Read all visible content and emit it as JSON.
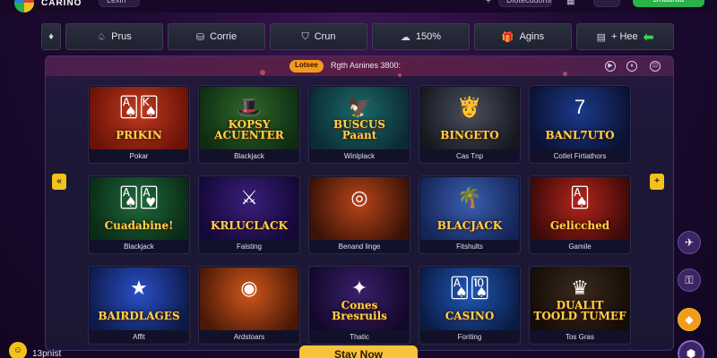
{
  "topbar": {
    "brand": "CARINO",
    "pill_left": "Lexin",
    "pill_right": "Dlotecudons",
    "right_button": "Drlaurau"
  },
  "nav": {
    "tabs": [
      {
        "icon": "diamond-icon",
        "label": "",
        "glyph": "♦"
      },
      {
        "icon": "cards-icon",
        "label": "Prus",
        "glyph": "♤"
      },
      {
        "icon": "chest-icon",
        "label": "Corrie",
        "glyph": "⛁"
      },
      {
        "icon": "shield-icon",
        "label": "Crun",
        "glyph": "⛉"
      },
      {
        "icon": "cloud-icon",
        "label": "150%",
        "glyph": "☁"
      },
      {
        "icon": "gift-icon",
        "label": "Agins",
        "glyph": "🎁"
      },
      {
        "icon": "wallet-icon",
        "label": "+ Hee",
        "glyph": "▤"
      }
    ]
  },
  "panel": {
    "badge": "Lotsee",
    "heading": "Rgth  Asnines  3800:",
    "controls": [
      "▶",
      "⏸",
      "⊡"
    ]
  },
  "games": [
    {
      "label": "Pokar",
      "art": "PRIKIN",
      "deco": "🂡🂮",
      "bg": [
        "#c0391e",
        "#6a1208"
      ]
    },
    {
      "label": "Blackjack",
      "art": "KOPSY\nACUENTER",
      "deco": "🎩",
      "bg": [
        "#2e6a2a",
        "#0f2c12"
      ]
    },
    {
      "label": "Winlplack",
      "art": "BUSCUS\nPaant",
      "deco": "🦅",
      "bg": [
        "#1c6a6a",
        "#0b2a33"
      ]
    },
    {
      "label": "Cas Tnp",
      "art": "BINGETO",
      "deco": "👸",
      "bg": [
        "#4a4f5e",
        "#16181f"
      ]
    },
    {
      "label": "Cotlet Firtiathors",
      "art": "BANL7UTO",
      "deco": "7",
      "bg": [
        "#1b3a8a",
        "#0a1233"
      ]
    },
    {
      "label": "Blackjack",
      "art": "Cuadabine!",
      "deco": "🂡🂱",
      "bg": [
        "#1f6a3a",
        "#0a2a16"
      ]
    },
    {
      "label": "Falsting",
      "art": "KRLUCLACK",
      "deco": "⚔",
      "bg": [
        "#3a1e7a",
        "#140838"
      ]
    },
    {
      "label": "Benand linge",
      "art": "",
      "deco": "◎",
      "bg": [
        "#b8441a",
        "#3a1206"
      ]
    },
    {
      "label": "Fitshults",
      "art": "BLACJACK",
      "deco": "🌴",
      "bg": [
        "#3a5fb0",
        "#142456"
      ]
    },
    {
      "label": "Gamile",
      "art": "Gelicched",
      "deco": "🂡",
      "bg": [
        "#b5241c",
        "#3a0a08"
      ]
    },
    {
      "label": "Afflt",
      "art": "BAIRDLAGES",
      "deco": "★",
      "bg": [
        "#2a50c8",
        "#0d1a4a"
      ]
    },
    {
      "label": "Ardstoars",
      "art": "",
      "deco": "◉",
      "bg": [
        "#d0561c",
        "#4a1806"
      ]
    },
    {
      "label": "Thatic",
      "art": "Cones\nBresruils",
      "deco": "✦",
      "bg": [
        "#3a1f6a",
        "#12082a"
      ]
    },
    {
      "label": "Foriting",
      "art": "CASINO",
      "deco": "🂡🂪",
      "bg": [
        "#1f58b8",
        "#0b1c44"
      ]
    },
    {
      "label": "Tos Gras",
      "art": "DUALIT\nTOOLD TUMEF",
      "deco": "♛",
      "bg": [
        "#3a2a1e",
        "#140c06"
      ]
    }
  ],
  "footer": {
    "user": "13pnist",
    "play_button": "Stay Now"
  },
  "colors": {
    "accent_yellow": "#f3c21a",
    "accent_green": "#2bb14a",
    "badge_orange": "#f39a1c"
  }
}
